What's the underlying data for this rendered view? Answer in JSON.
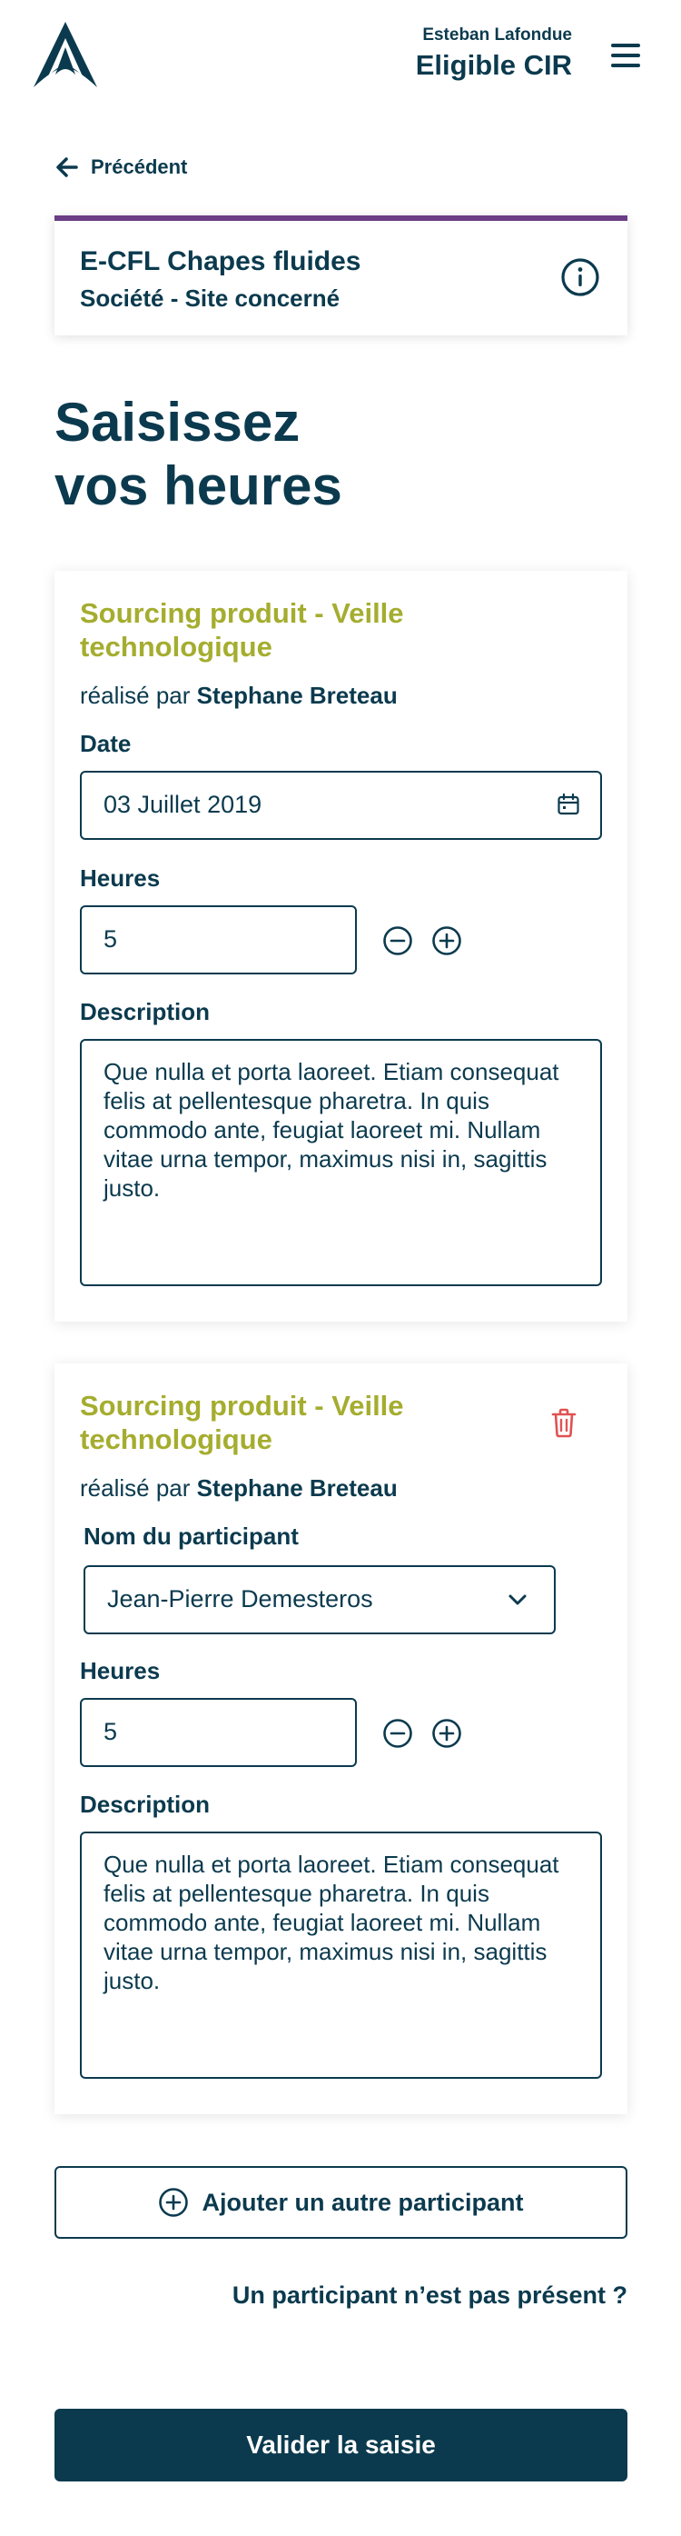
{
  "header": {
    "user_name": "Esteban Lafondue",
    "user_role": "Eligible CIR",
    "logo_icon": "triangle-logo-icon",
    "menu_icon": "hamburger-icon"
  },
  "nav": {
    "back_label": "Précédent"
  },
  "project": {
    "title": "E-CFL Chapes fluides",
    "subtitle": "Société - Site concerné",
    "accent_color": "#6b3d85"
  },
  "page": {
    "title_line1": "Saisissez",
    "title_line2": "vos heures"
  },
  "entries": [
    {
      "title": "Sourcing produit - Veille technologique",
      "done_by_prefix": "réalisé par",
      "done_by_name": "Stephane Breteau",
      "date_label": "Date",
      "date_value": "03 Juillet 2019",
      "hours_label": "Heures",
      "hours_value": "5",
      "description_label": "Description",
      "description_value": "Que nulla et porta laoreet. Etiam consequat felis at pellentesque pharetra. In quis commodo ante, feugiat laoreet mi. Nullam vitae urna tempor, maximus nisi in, sagittis justo."
    },
    {
      "title": "Sourcing produit - Veille technologique",
      "done_by_prefix": "réalisé par",
      "done_by_name": "Stephane Breteau",
      "participant_label": "Nom du participant",
      "participant_value": "Jean-Pierre Demesteros",
      "hours_label": "Heures",
      "hours_value": "5",
      "description_label": "Description",
      "description_value": "Que nulla et porta laoreet. Etiam consequat felis at pellentesque pharetra. In quis commodo ante, feugiat laoreet mi. Nullam vitae urna tempor, maximus nisi in, sagittis justo."
    }
  ],
  "actions": {
    "add_participant": "Ajouter un autre participant",
    "missing_participant": "Un participant n’est pas présent ?",
    "submit": "Valider la saisie"
  },
  "colors": {
    "primary": "#0b3a4e",
    "entry_title": "#a5ad2f",
    "delete": "#e05252"
  }
}
